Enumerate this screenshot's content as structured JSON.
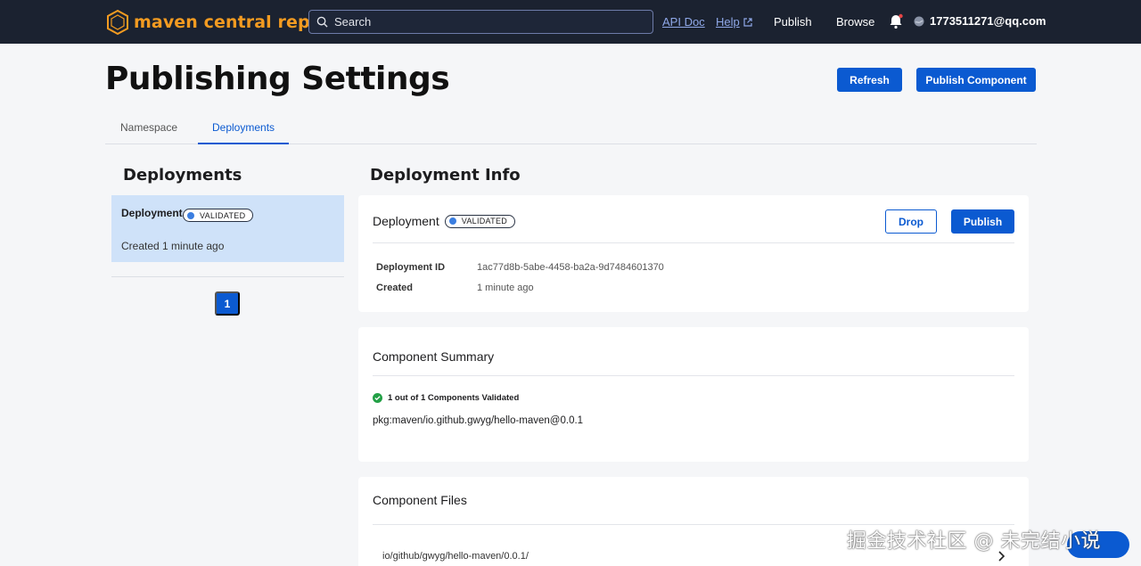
{
  "nav": {
    "logo_text": "maven central repository",
    "search_placeholder": "Search",
    "api_doc": "API Doc",
    "help": "Help",
    "publish": "Publish",
    "browse": "Browse",
    "user_email": "1773511271@qq.com"
  },
  "page": {
    "title": "Publishing Settings",
    "refresh_label": "Refresh",
    "publish_component_label": "Publish Component"
  },
  "tabs": [
    {
      "label": "Namespace",
      "active": false
    },
    {
      "label": "Deployments",
      "active": true
    }
  ],
  "left": {
    "title": "Deployments",
    "items": [
      {
        "label": "Deployment",
        "status": "VALIDATED",
        "created": "Created 1 minute ago"
      }
    ],
    "current_page": "1"
  },
  "deployment_info": {
    "title": "Deployment Info",
    "card_title": "Deployment",
    "status": "VALIDATED",
    "drop_label": "Drop",
    "publish_label": "Publish",
    "fields": [
      {
        "key": "Deployment ID",
        "value": "1ac77d8b-5abe-4458-ba2a-9d7484601370"
      },
      {
        "key": "Created",
        "value": "1 minute ago"
      }
    ]
  },
  "component_summary": {
    "title": "Component Summary",
    "validated_text": "1 out of 1 Components Validated",
    "purl": "pkg:maven/io.github.gwyg/hello-maven@0.0.1"
  },
  "component_files": {
    "title": "Component Files",
    "files": [
      {
        "path": "io/github/gwyg/hello-maven/0.0.1/"
      }
    ]
  },
  "watermark": "掘金技术社区 @ 未完结小说",
  "colors": {
    "topbar": "#1b2230",
    "accent": "#0b5ad1",
    "brand": "#f39b21",
    "selected_bg": "#cfe2f9",
    "success": "#23a046"
  }
}
